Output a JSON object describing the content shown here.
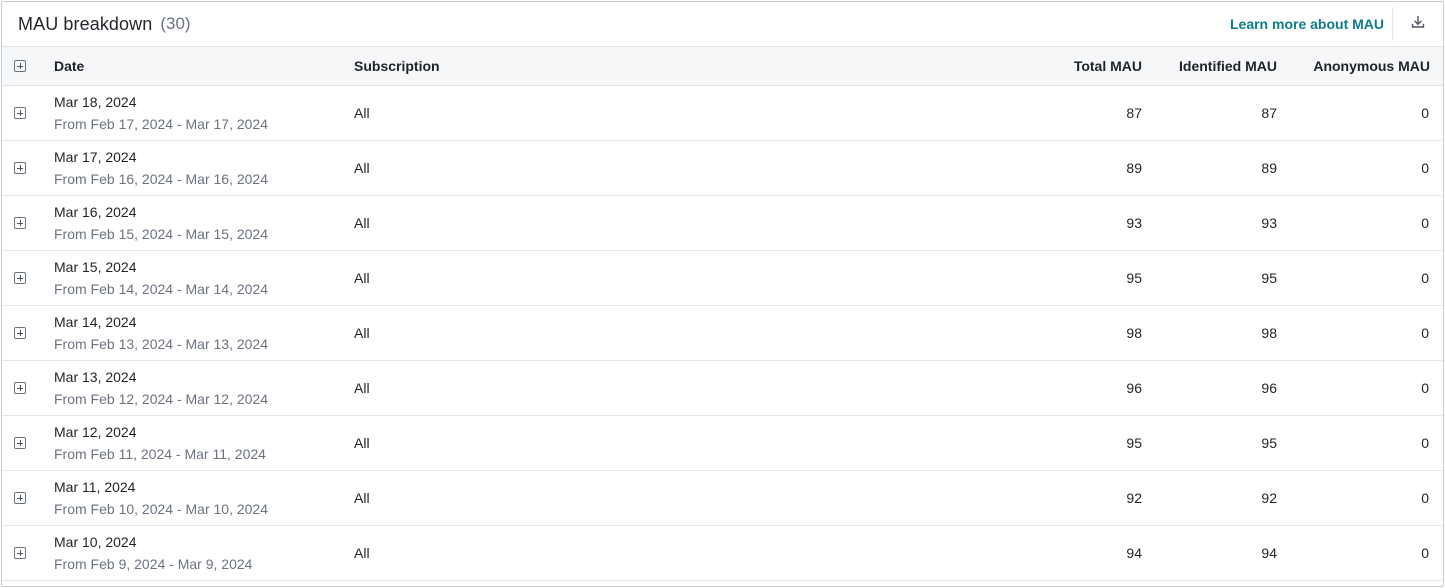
{
  "header": {
    "title": "MAU breakdown",
    "count": "(30)",
    "learn_more": "Learn more about MAU",
    "download_icon": "download-icon"
  },
  "table": {
    "columns": {
      "date": "Date",
      "subscription": "Subscription",
      "total": "Total MAU",
      "identified": "Identified MAU",
      "anonymous": "Anonymous MAU"
    },
    "rows": [
      {
        "date": "Mar 18, 2024",
        "range": "From Feb 17, 2024 - Mar 17, 2024",
        "subscription": "All",
        "total": "87",
        "identified": "87",
        "anonymous": "0"
      },
      {
        "date": "Mar 17, 2024",
        "range": "From Feb 16, 2024 - Mar 16, 2024",
        "subscription": "All",
        "total": "89",
        "identified": "89",
        "anonymous": "0"
      },
      {
        "date": "Mar 16, 2024",
        "range": "From Feb 15, 2024 - Mar 15, 2024",
        "subscription": "All",
        "total": "93",
        "identified": "93",
        "anonymous": "0"
      },
      {
        "date": "Mar 15, 2024",
        "range": "From Feb 14, 2024 - Mar 14, 2024",
        "subscription": "All",
        "total": "95",
        "identified": "95",
        "anonymous": "0"
      },
      {
        "date": "Mar 14, 2024",
        "range": "From Feb 13, 2024 - Mar 13, 2024",
        "subscription": "All",
        "total": "98",
        "identified": "98",
        "anonymous": "0"
      },
      {
        "date": "Mar 13, 2024",
        "range": "From Feb 12, 2024 - Mar 12, 2024",
        "subscription": "All",
        "total": "96",
        "identified": "96",
        "anonymous": "0"
      },
      {
        "date": "Mar 12, 2024",
        "range": "From Feb 11, 2024 - Mar 11, 2024",
        "subscription": "All",
        "total": "95",
        "identified": "95",
        "anonymous": "0"
      },
      {
        "date": "Mar 11, 2024",
        "range": "From Feb 10, 2024 - Mar 10, 2024",
        "subscription": "All",
        "total": "92",
        "identified": "92",
        "anonymous": "0"
      },
      {
        "date": "Mar 10, 2024",
        "range": "From Feb 9, 2024 - Mar 9, 2024",
        "subscription": "All",
        "total": "94",
        "identified": "94",
        "anonymous": "0"
      }
    ]
  },
  "colors": {
    "accent": "#0e7c86",
    "header_bg": "#f6f7f8",
    "muted_text": "#6b7280"
  }
}
